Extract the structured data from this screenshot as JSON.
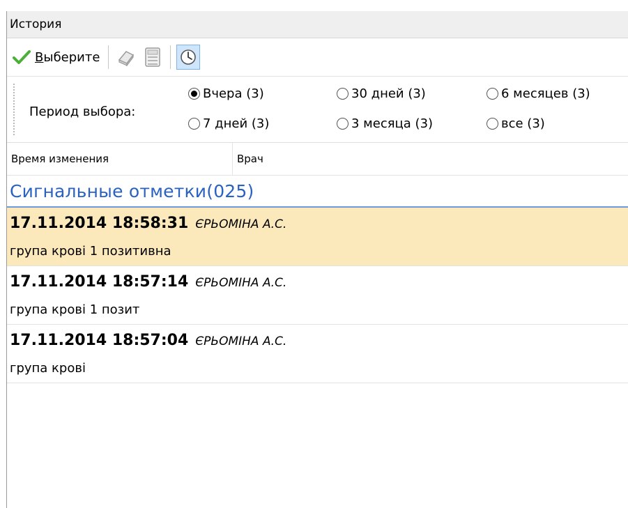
{
  "window": {
    "title": "История"
  },
  "toolbar": {
    "select_label": "Выберите",
    "select_underline": "В",
    "select_rest": "ыберите"
  },
  "period": {
    "label": "Период выбора:",
    "options": [
      {
        "label": "Вчера (3)",
        "selected": true
      },
      {
        "label": "30 дней (3)",
        "selected": false
      },
      {
        "label": "6 месяцев (3)",
        "selected": false
      },
      {
        "label": "7 дней (3)",
        "selected": false
      },
      {
        "label": "3 месяца (3)",
        "selected": false
      },
      {
        "label": "все (3)",
        "selected": false
      }
    ]
  },
  "grid": {
    "columns": [
      "Время изменения",
      "Врач"
    ],
    "group_title": "Сигнальные отметки(025)",
    "records": [
      {
        "datetime": "17.11.2014 18:58:31",
        "doctor": "ЄРЬОМІНА А.С.",
        "note": "група крові 1 позитивна",
        "selected": true
      },
      {
        "datetime": "17.11.2014 18:57:14",
        "doctor": "ЄРЬОМІНА А.С.",
        "note": "група крові 1 позит",
        "selected": false
      },
      {
        "datetime": "17.11.2014 18:57:04",
        "doctor": "ЄРЬОМІНА А.С.",
        "note": "група крові",
        "selected": false
      }
    ]
  },
  "colors": {
    "accent_blue": "#2a62c2",
    "selected_row": "#fbe9bb",
    "check_green": "#4caf3a"
  },
  "icons": [
    "check-icon",
    "eraser-icon",
    "calculator-icon",
    "clock-icon"
  ]
}
